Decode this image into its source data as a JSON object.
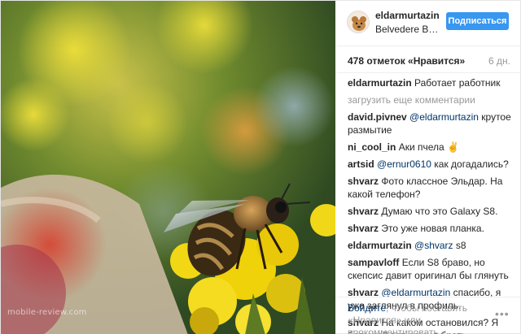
{
  "header": {
    "username": "eldarmurtazin",
    "location": "Belvedere Bot…",
    "follow_label": "Подписаться"
  },
  "meta": {
    "likes": "478 отметок «Нравится»",
    "age": "6 дн."
  },
  "caption": {
    "author": "eldarmurtazin",
    "text": "Работает работник"
  },
  "load_more": "загрузить еще комментарии",
  "comments": [
    {
      "author": "david.pivnev",
      "mention": "@eldarmurtazin",
      "text": "крутое размытие"
    },
    {
      "author": "ni_cool_in",
      "mention": "",
      "text": "Аки пчела ✌"
    },
    {
      "author": "artsid",
      "mention": "@ernur0610",
      "text": "как догадались?"
    },
    {
      "author": "shvarz",
      "mention": "",
      "text": "Фото классное Эльдар. На какой телефон?"
    },
    {
      "author": "shvarz",
      "mention": "",
      "text": "Думаю что это Galaxy S8."
    },
    {
      "author": "shvarz",
      "mention": "",
      "text": "Это уже новая планка."
    },
    {
      "author": "eldarmurtazin",
      "mention": "@shvarz",
      "text": "s8"
    },
    {
      "author": "sampavloff",
      "mention": "",
      "text": "Если S8 браво, но скепсис давит оригинал бы глянуть"
    },
    {
      "author": "shvarz",
      "mention": "@eldarmurtazin",
      "text": "спасибо, я уже заглянул в профиль."
    },
    {
      "author": "shvarz",
      "mention": "",
      "text": "На каком остановился? Я большой вот решил брать."
    }
  ],
  "footer": {
    "login_link": "Войдите",
    "login_rest": ", чтобы поставить «Нравится» или прокомментировать.",
    "more_icon": "•••"
  },
  "photo": {
    "watermark": "mobile-review.com"
  }
}
